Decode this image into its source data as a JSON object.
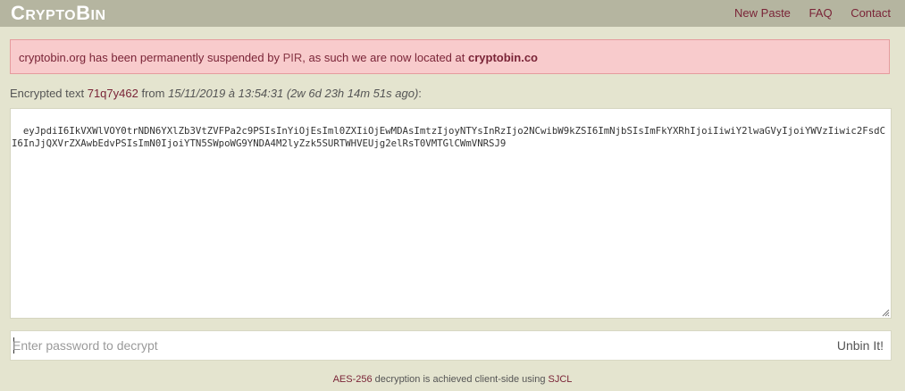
{
  "header": {
    "brand_first": "C",
    "brand_rest1": "RYPTO",
    "brand_second": "B",
    "brand_rest2": "IN",
    "nav": [
      "New Paste",
      "FAQ",
      "Contact"
    ]
  },
  "alert": {
    "text1": "cryptobin.org has been permanently suspended by ",
    "link1": "PIR",
    "text2": ", as such we are now located at ",
    "link2": "cryptobin.co"
  },
  "paste": {
    "label": "Encrypted text ",
    "id": "71q7y462",
    "from": " from ",
    "date": "15/11/2019 à 13:54:31",
    "ago": " (2w 6d 23h 14m 51s ago)",
    "colon": ":",
    "ciphertext": "eyJpdiI6IkVXWlVOY0trNDN6YXlZb3VtZVFPa2c9PSIsInYiOjEsIml0ZXIiOjEwMDAsImtzIjoyNTYsInRzIjo2NCwibW9kZSI6ImNjbSIsImFkYXRhIjoiIiwiY2lwaGVyIjoiYWVzIiwic2FsdCI6InJjQXVrZXAwbEdvPSIsImN0IjoiYTN5SWpoWG9YNDA4M2lyZzk5SURTWHVEUjg2elRsT0VMTGlCWmVNRSJ9"
  },
  "password": {
    "placeholder": "Enter password to decrypt",
    "value": "",
    "button": "Unbin It!"
  },
  "footer": {
    "link1": "AES-256",
    "text1": " decryption is achieved client-side using ",
    "link2": "SJCL"
  },
  "colors": {
    "background": "#e4e4cf",
    "topbar": "#b5b5a0",
    "accent": "#7a2437",
    "alert_bg": "#f8cbcc"
  }
}
